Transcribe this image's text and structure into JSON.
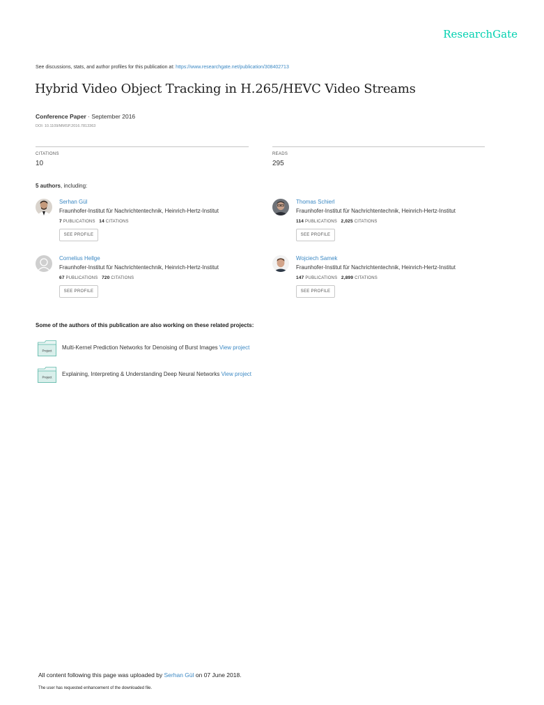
{
  "brand": {
    "logo": "ResearchGate",
    "accent": "#00d0af",
    "link_color": "#3b88c3"
  },
  "header": {
    "discuss_prefix": "See discussions, stats, and author profiles for this publication at: ",
    "discuss_url": "https://www.researchgate.net/publication/308402713"
  },
  "publication": {
    "title": "Hybrid Video Object Tracking in H.265/HEVC Video Streams",
    "type": "Conference Paper",
    "date_sep": " · ",
    "date": "September 2016",
    "doi": "DOI: 10.1109/MMSP.2016.7813363"
  },
  "stats": {
    "citations_label": "CITATIONS",
    "citations_value": "10",
    "reads_label": "READS",
    "reads_value": "295"
  },
  "authors_section": {
    "count_bold": "5 authors",
    "suffix": ", including:"
  },
  "authors": [
    {
      "name": "Serhan Gül",
      "institution": "Fraunhofer-Institut für Nachrichtentechnik, Heinrich-Hertz-Institut",
      "publications": "7",
      "publications_label": "PUBLICATIONS",
      "citations": "14",
      "citations_label": "CITATIONS",
      "button": "SEE PROFILE",
      "avatar_icon": "author-photo"
    },
    {
      "name": "Thomas Schierl",
      "institution": "Fraunhofer-Institut für Nachrichtentechnik, Heinrich-Hertz-Institut",
      "publications": "114",
      "publications_label": "PUBLICATIONS",
      "citations": "2,025",
      "citations_label": "CITATIONS",
      "button": "SEE PROFILE",
      "avatar_icon": "author-photo"
    },
    {
      "name": "Cornelius Hellge",
      "institution": "Fraunhofer-Institut für Nachrichtentechnik, Heinrich-Hertz-Institut",
      "publications": "67",
      "publications_label": "PUBLICATIONS",
      "citations": "720",
      "citations_label": "CITATIONS",
      "button": "SEE PROFILE",
      "avatar_icon": "default-user-icon"
    },
    {
      "name": "Wojciech Samek",
      "institution": "Fraunhofer-Institut für Nachrichtentechnik, Heinrich-Hertz-Institut",
      "publications": "147",
      "publications_label": "PUBLICATIONS",
      "citations": "2,899",
      "citations_label": "CITATIONS",
      "button": "SEE PROFILE",
      "avatar_icon": "author-photo"
    }
  ],
  "related": {
    "heading": "Some of the authors of this publication are also working on these related projects:",
    "projects": [
      {
        "icon_label": "Project",
        "title": "Multi-Kernel Prediction Networks for Denoising of Burst Images",
        "link": "View project"
      },
      {
        "icon_label": "Project",
        "title": "Explaining, Interpreting & Understanding Deep Neural Networks",
        "link": "View project"
      }
    ]
  },
  "footer": {
    "upload_prefix": "All content following this page was uploaded by ",
    "uploader": "Serhan Gül",
    "upload_suffix": " on 07 June 2018.",
    "note": "The user has requested enhancement of the downloaded file."
  }
}
